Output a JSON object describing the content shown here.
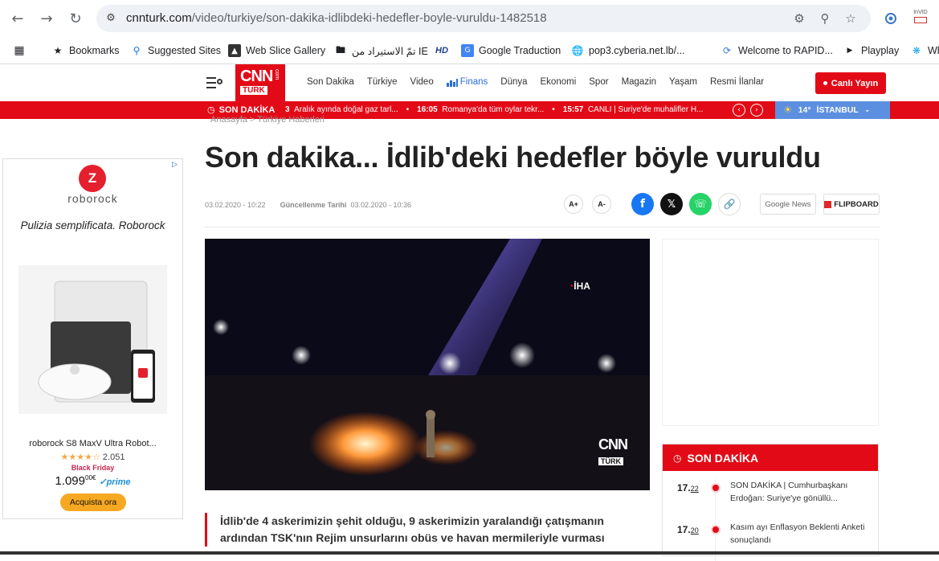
{
  "browser": {
    "url_host": "cnnturk.com",
    "url_path": "/video/turkiye/son-dakika-idlibdeki-hedefler-boyle-vuruldu-1482518",
    "bookmarks": [
      {
        "label": "Bookmarks",
        "icon": "star-icon"
      },
      {
        "label": "Suggested Sites",
        "icon": "search-icon"
      },
      {
        "label": "Web Slice Gallery",
        "icon": "slice-icon"
      },
      {
        "label": "تمّ الاستيراد من IE",
        "icon": "folder-icon"
      },
      {
        "label": "",
        "icon": "hd-icon"
      },
      {
        "label": "Google Traduction",
        "icon": "translate-icon"
      },
      {
        "label": "pop3.cyberia.net.lb/...",
        "icon": "globe-icon"
      },
      {
        "label": "Welcome to RAPID...",
        "icon": "rapid-icon"
      },
      {
        "label": "Playplay",
        "icon": "playplay-icon"
      },
      {
        "label": "Wh",
        "icon": "wh-icon"
      }
    ],
    "hd_text": "HD",
    "invid_text": "InVID"
  },
  "site": {
    "logo": {
      "cnn": "CNN",
      "turk": "TÜRK",
      "com": "com"
    },
    "menu": [
      "Son Dakika",
      "Türkiye",
      "Video",
      "Finans",
      "Dünya",
      "Ekonomi",
      "Spor",
      "Magazin",
      "Yaşam",
      "Resmi İlanlar"
    ],
    "live_label": "Canlı Yayın",
    "ticker": {
      "label": "SON DAKİKA",
      "items": [
        {
          "time": "3",
          "text": "Aralık ayında doğal gaz tarl..."
        },
        {
          "time": "16:05",
          "text": "Romanya'da tüm oylar tekr..."
        },
        {
          "time": "15:57",
          "text": "CANLI | Suriye'de muhalifler H..."
        }
      ]
    },
    "weather": {
      "temp": "14°",
      "city": "İSTANBUL"
    },
    "breadcrumb": "Anasayfa  >  Türkiye Haberleri"
  },
  "ad_left": {
    "brand": "roborock",
    "tagline": "Pulizia semplificata. Roborock",
    "product": "roborock S8 MaxV Ultra Robot...",
    "rating_count": "2.051",
    "badge": "Black Friday",
    "price_main": "1.099",
    "price_cents": "00€",
    "prime": "prime",
    "cta": "Acquista ora",
    "rating": 4.5
  },
  "article": {
    "headline": "Son dakika... İdlib'deki hedefler böyle vuruldu",
    "published": "03.02.2020 - 10:22",
    "updated_label": "Güncellenme Tarihi",
    "updated": "03.02.2020 - 10:36",
    "font_plus": "A+",
    "font_minus": "A-",
    "google_news": "Google News",
    "flipboard": "FLIPBOARD",
    "video_watermark_iha": "İHA",
    "lead": "İdlib'de 4 askerimizin şehit olduğu, 9 askerimizin yaralandığı çatışmanın ardından TSK'nın Rejim unsurlarını obüs ve havan mermileriyle vurması"
  },
  "son_dakika_box": {
    "title": "SON DAKİKA",
    "items": [
      {
        "hour": "17.",
        "min": "22",
        "text": "SON DAKİKA | Cumhurbaşkanı Erdoğan: Suriye'ye gönüllü..."
      },
      {
        "hour": "17.",
        "min": "20",
        "text": "Kasım ayı Enflasyon Beklenti Anketi sonuçlandı"
      }
    ]
  },
  "colors": {
    "brand_red": "#e30a17",
    "weather_blue": "#5c8fe0",
    "facebook": "#1877f2",
    "whatsapp": "#25d366"
  }
}
